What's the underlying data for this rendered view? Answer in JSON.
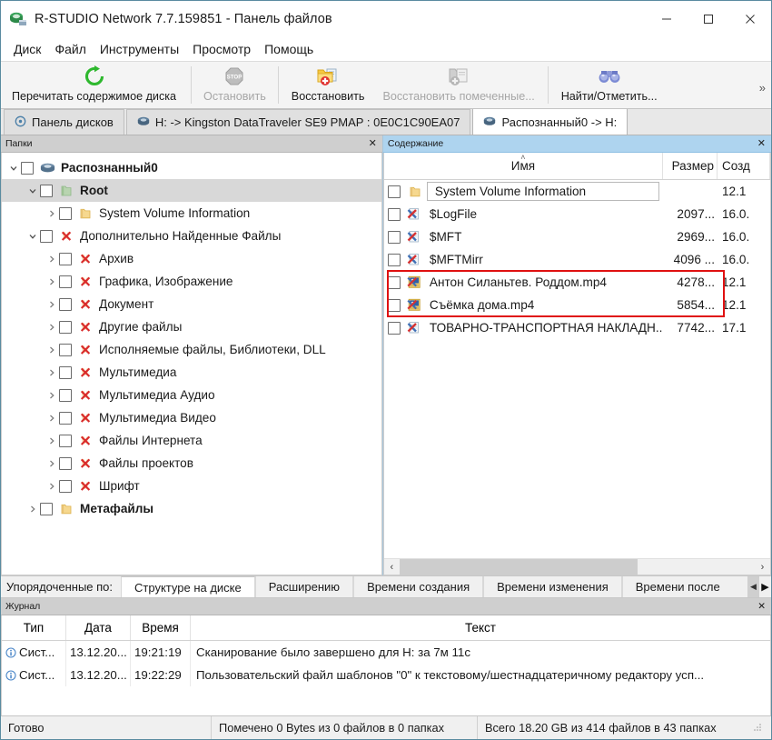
{
  "window": {
    "title": "R-STUDIO Network 7.7.159851 - Панель файлов",
    "app_icon": "disk-drive-icon",
    "minimize_label": "─",
    "maximize_label": "☐",
    "close_label": "✕"
  },
  "menu": {
    "items": [
      {
        "label": "Диск"
      },
      {
        "label": "Файл"
      },
      {
        "label": "Инструменты"
      },
      {
        "label": "Просмотр"
      },
      {
        "label": "Помощь"
      }
    ]
  },
  "toolbar": {
    "overflow_label": "»",
    "buttons": [
      {
        "label": "Перечитать содержимое диска",
        "icon": "refresh-icon",
        "disabled": false
      },
      {
        "label": "Остановить",
        "icon": "stop-icon",
        "disabled": true
      },
      {
        "label": "Восстановить",
        "icon": "recover-folder-icon",
        "disabled": false
      },
      {
        "label": "Восстановить помеченные...",
        "icon": "recover-marked-icon",
        "disabled": true
      },
      {
        "label": "Найти/Отметить...",
        "icon": "binoculars-icon",
        "disabled": false
      }
    ]
  },
  "tabs": [
    {
      "label": "Панель дисков",
      "icon": "drive-panel-icon",
      "active": false
    },
    {
      "label": "H: -> Kingston DataTraveler SE9 PMAP : 0E0C1C90EA07",
      "icon": "disk-icon",
      "active": false
    },
    {
      "label": "Распознанный0 -> H:",
      "icon": "disk-icon",
      "active": true
    }
  ],
  "folders_pane": {
    "header": "Папки",
    "close_label": "✕",
    "tree": [
      {
        "label": "Распознанный0",
        "depth": 0,
        "twist": "down",
        "icon": "disk-icon",
        "bold": true,
        "selected": false
      },
      {
        "label": "Root",
        "depth": 1,
        "twist": "down",
        "icon": "folder-green-icon",
        "bold": true,
        "selected": true
      },
      {
        "label": "System Volume Information",
        "depth": 2,
        "twist": "right",
        "icon": "folder-yellow-icon",
        "bold": false,
        "selected": false
      },
      {
        "label": "Дополнительно Найденные Файлы",
        "depth": 1,
        "twist": "down",
        "icon": "red-x-icon",
        "bold": false,
        "selected": false
      },
      {
        "label": "Архив",
        "depth": 2,
        "twist": "right",
        "icon": "red-x-icon",
        "bold": false,
        "selected": false
      },
      {
        "label": "Графика, Изображение",
        "depth": 2,
        "twist": "right",
        "icon": "red-x-icon",
        "bold": false,
        "selected": false
      },
      {
        "label": "Документ",
        "depth": 2,
        "twist": "right",
        "icon": "red-x-icon",
        "bold": false,
        "selected": false
      },
      {
        "label": "Другие файлы",
        "depth": 2,
        "twist": "right",
        "icon": "red-x-icon",
        "bold": false,
        "selected": false
      },
      {
        "label": "Исполняемые файлы, Библиотеки, DLL",
        "depth": 2,
        "twist": "right",
        "icon": "red-x-icon",
        "bold": false,
        "selected": false
      },
      {
        "label": "Мультимедиа",
        "depth": 2,
        "twist": "right",
        "icon": "red-x-icon",
        "bold": false,
        "selected": false
      },
      {
        "label": "Мультимедиа Аудио",
        "depth": 2,
        "twist": "right",
        "icon": "red-x-icon",
        "bold": false,
        "selected": false
      },
      {
        "label": "Мультимедиа Видео",
        "depth": 2,
        "twist": "right",
        "icon": "red-x-icon",
        "bold": false,
        "selected": false
      },
      {
        "label": "Файлы Интернета",
        "depth": 2,
        "twist": "right",
        "icon": "red-x-icon",
        "bold": false,
        "selected": false
      },
      {
        "label": "Файлы проектов",
        "depth": 2,
        "twist": "right",
        "icon": "red-x-icon",
        "bold": false,
        "selected": false
      },
      {
        "label": "Шрифт",
        "depth": 2,
        "twist": "right",
        "icon": "red-x-icon",
        "bold": false,
        "selected": false
      },
      {
        "label": "Метафайлы",
        "depth": 1,
        "twist": "right",
        "icon": "folder-yellow-icon",
        "bold": true,
        "selected": false
      }
    ]
  },
  "contents_pane": {
    "header": "Содержание",
    "close_label": "✕",
    "columns": [
      {
        "label": "Имя",
        "sorted": "asc",
        "sort_caret": "˄"
      },
      {
        "label": "Размер",
        "sorted": ""
      },
      {
        "label": "Созд",
        "sorted": ""
      }
    ],
    "rows": [
      {
        "name": "System Volume Information",
        "size": "",
        "date": "12.1",
        "icon": "folder-yellow-icon",
        "boxed": true,
        "highlighted": false
      },
      {
        "name": "$LogFile",
        "size": "2097...",
        "date": "16.0.",
        "icon": "deleted-file-icon",
        "boxed": false,
        "highlighted": false
      },
      {
        "name": "$MFT",
        "size": "2969...",
        "date": "16.0.",
        "icon": "deleted-file-icon",
        "boxed": false,
        "highlighted": false
      },
      {
        "name": "$MFTMirr",
        "size": "4096 ...",
        "date": "16.0.",
        "icon": "deleted-file-icon",
        "boxed": false,
        "highlighted": false
      },
      {
        "name": "Антон Силаньтев. Роддом.mp4",
        "size": "4278...",
        "date": "12.1",
        "icon": "video-file-icon",
        "boxed": false,
        "highlighted": true
      },
      {
        "name": "Съёмка дома.mp4",
        "size": "5854...",
        "date": "12.1",
        "icon": "video-file-icon",
        "boxed": false,
        "highlighted": true
      },
      {
        "name": "ТОВАРНО-ТРАНСПОРТНАЯ НАКЛАДН...",
        "size": "7742...",
        "date": "17.1",
        "icon": "deleted-file-icon",
        "boxed": false,
        "highlighted": false
      }
    ],
    "hscroll": {
      "left_arrow": "‹",
      "right_arrow": "›"
    }
  },
  "sort_tabs": {
    "label": "Упорядоченные по:",
    "tabs": [
      {
        "label": "Структуре на диске",
        "active": true
      },
      {
        "label": "Расширению",
        "active": false
      },
      {
        "label": "Времени создания",
        "active": false
      },
      {
        "label": "Времени изменения",
        "active": false
      },
      {
        "label": "Времени после",
        "active": false
      }
    ],
    "scroll_left": "◀",
    "scroll_right": "▶"
  },
  "journal": {
    "header": "Журнал",
    "close_label": "✕",
    "columns": [
      "Тип",
      "Дата",
      "Время",
      "Текст"
    ],
    "rows": [
      {
        "type": "Сист...",
        "date": "13.12.20...",
        "time": "19:21:19",
        "text": "Сканирование было завершено для H: за 7м 11с",
        "icon": "info-icon"
      },
      {
        "type": "Сист...",
        "date": "13.12.20...",
        "time": "19:22:29",
        "text": "Пользовательский файл шаблонов \"0\" к текстовому/шестнадцатеричному редактору усп...",
        "icon": "info-icon"
      }
    ]
  },
  "statusbar": {
    "ready": "Готово",
    "marked": "Помечено 0 Bytes из 0 файлов в 0 папках",
    "total": "Всего 18.20 GB из 414 файлов в 43 папках"
  },
  "colors": {
    "accent_blue": "#aed4ef",
    "pane_gray": "#cfcfcf",
    "highlight_red": "#e01111",
    "selection_gray": "#d8d8d8",
    "refresh_green": "#2eb82e"
  }
}
